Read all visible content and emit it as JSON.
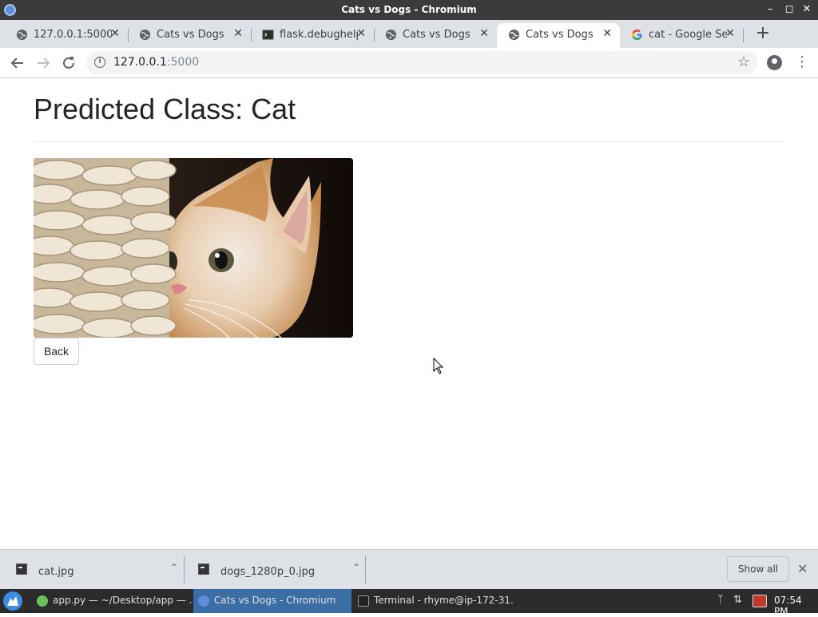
{
  "window": {
    "title": "Cats vs Dogs - Chromium"
  },
  "tabs": [
    {
      "label": "127.0.0.1:5000",
      "icon": "globe-icon",
      "active": false
    },
    {
      "label": "Cats vs Dogs",
      "icon": "globe-icon",
      "active": false
    },
    {
      "label": "flask.debughelp",
      "icon": "terminal-icon",
      "active": false
    },
    {
      "label": "Cats vs Dogs",
      "icon": "globe-icon",
      "active": false
    },
    {
      "label": "Cats vs Dogs",
      "icon": "globe-icon",
      "active": true
    },
    {
      "label": "cat - Google Sea",
      "icon": "google-icon",
      "active": false
    }
  ],
  "toolbar": {
    "url_host": "127.0.0.1",
    "url_port": ":5000"
  },
  "page": {
    "heading": "Predicted Class: Cat",
    "image_alt": "cat photo",
    "back_label": "Back"
  },
  "downloads": {
    "items": [
      {
        "name": "cat.jpg"
      },
      {
        "name": "dogs_1280p_0.jpg"
      }
    ],
    "show_all": "Show all"
  },
  "taskbar": {
    "tasks": [
      {
        "label": "app.py — ~/Desktop/app — ...",
        "icon": "editor-icon"
      },
      {
        "label": "Cats vs Dogs - Chromium",
        "icon": "chromium-icon",
        "active": true
      },
      {
        "label": "Terminal - rhyme@ip-172-31...",
        "icon": "terminal-icon"
      }
    ],
    "clock": "07:54 PM"
  }
}
